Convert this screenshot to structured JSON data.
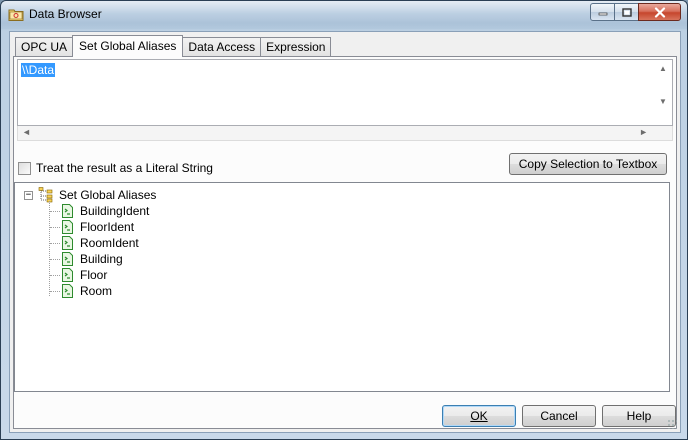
{
  "window": {
    "title": "Data Browser",
    "min_icon": "minimize-icon",
    "max_icon": "maximize-icon",
    "close_icon": "close-icon"
  },
  "tabs": [
    {
      "label": "OPC UA",
      "active": false
    },
    {
      "label": "Set Global Aliases",
      "active": true
    },
    {
      "label": "Data Access",
      "active": false
    },
    {
      "label": "Expression",
      "active": false
    }
  ],
  "textbox": {
    "value": "\\\\Data"
  },
  "literal_checkbox": {
    "label": "Treat the result as a Literal String",
    "checked": false
  },
  "copy_button": {
    "label": "Copy Selection to Textbox"
  },
  "tree": {
    "root": {
      "label": "Set Global Aliases",
      "expander": "−",
      "icon": "alias-tree-icon"
    },
    "items": [
      {
        "label": "BuildingIdent",
        "icon": "tag-icon"
      },
      {
        "label": "FloorIdent",
        "icon": "tag-icon"
      },
      {
        "label": "RoomIdent",
        "icon": "tag-icon"
      },
      {
        "label": "Building",
        "icon": "tag-icon"
      },
      {
        "label": "Floor",
        "icon": "tag-icon"
      },
      {
        "label": "Room",
        "icon": "tag-icon"
      }
    ]
  },
  "buttons": {
    "ok": "OK",
    "cancel": "Cancel",
    "help": "Help"
  },
  "colors": {
    "selection": "#3399ff",
    "close_button": "#c6462d",
    "leaf_icon": "#2e8b2e"
  }
}
